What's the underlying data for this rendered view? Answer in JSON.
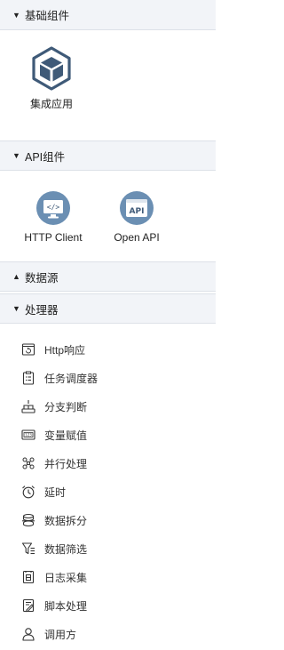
{
  "sections": {
    "basic": {
      "title": "基础组件",
      "caret": "▼"
    },
    "api": {
      "title": "API组件",
      "caret": "▼"
    },
    "datasource": {
      "title": "数据源",
      "caret": "▲"
    },
    "processor": {
      "title": "处理器",
      "caret": "▼"
    }
  },
  "basic_components": [
    {
      "label": "集成应用",
      "icon": "cube-icon"
    }
  ],
  "api_components": [
    {
      "label": "HTTP Client",
      "icon": "code-monitor-icon"
    },
    {
      "label": "Open API",
      "icon": "api-window-icon"
    }
  ],
  "processors": [
    {
      "label": "Http响应",
      "icon": "http-response-icon"
    },
    {
      "label": "任务调度器",
      "icon": "task-scheduler-icon"
    },
    {
      "label": "分支判断",
      "icon": "branch-icon"
    },
    {
      "label": "变量赋值",
      "icon": "variable-icon"
    },
    {
      "label": "并行处理",
      "icon": "parallel-icon"
    },
    {
      "label": "延时",
      "icon": "alarm-clock-icon"
    },
    {
      "label": "数据拆分",
      "icon": "data-split-icon"
    },
    {
      "label": "数据筛选",
      "icon": "filter-icon"
    },
    {
      "label": "日志采集",
      "icon": "log-icon"
    },
    {
      "label": "脚本处理",
      "icon": "script-icon"
    },
    {
      "label": "调用方",
      "icon": "user-icon"
    }
  ],
  "colors": {
    "cube": "#3f5a78",
    "api_icon_bg": "#6b8fb3",
    "header_bg": "#f2f4f8"
  }
}
